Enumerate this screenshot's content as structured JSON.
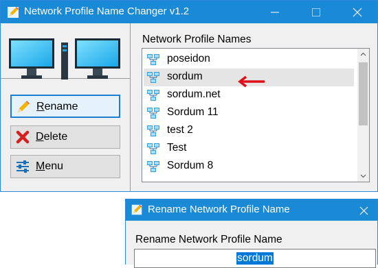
{
  "main_window": {
    "title": "Network Profile Name Changer v1.2",
    "controls": {
      "minimize": "minimize",
      "maximize": "maximize",
      "close": "close"
    }
  },
  "actions": {
    "rename_label": "Rename",
    "delete_label": "Delete",
    "menu_label": "Menu"
  },
  "list": {
    "heading": "Network Profile Names",
    "items": [
      {
        "label": "poseidon"
      },
      {
        "label": "sordum"
      },
      {
        "label": "sordum.net"
      },
      {
        "label": "Sordum 11"
      },
      {
        "label": "test 2"
      },
      {
        "label": "Test"
      },
      {
        "label": "Sordum 8"
      }
    ],
    "selected_index": 1,
    "scroll_position": 0.0
  },
  "dialog": {
    "title": "Rename Network Profile Name",
    "field_label": "Rename Network Profile Name",
    "field_value": "sordum"
  },
  "colors": {
    "titlebar": "#1a8ad6",
    "focus_border": "#1a7fd0",
    "annotation_arrow": "#e0101a",
    "selection_highlight": "#0078d7"
  },
  "icons": {
    "app": "pencil-icon",
    "rename": "pencil-icon",
    "delete": "red-x-icon",
    "menu": "sliders-icon",
    "list_item": "network-icon"
  }
}
